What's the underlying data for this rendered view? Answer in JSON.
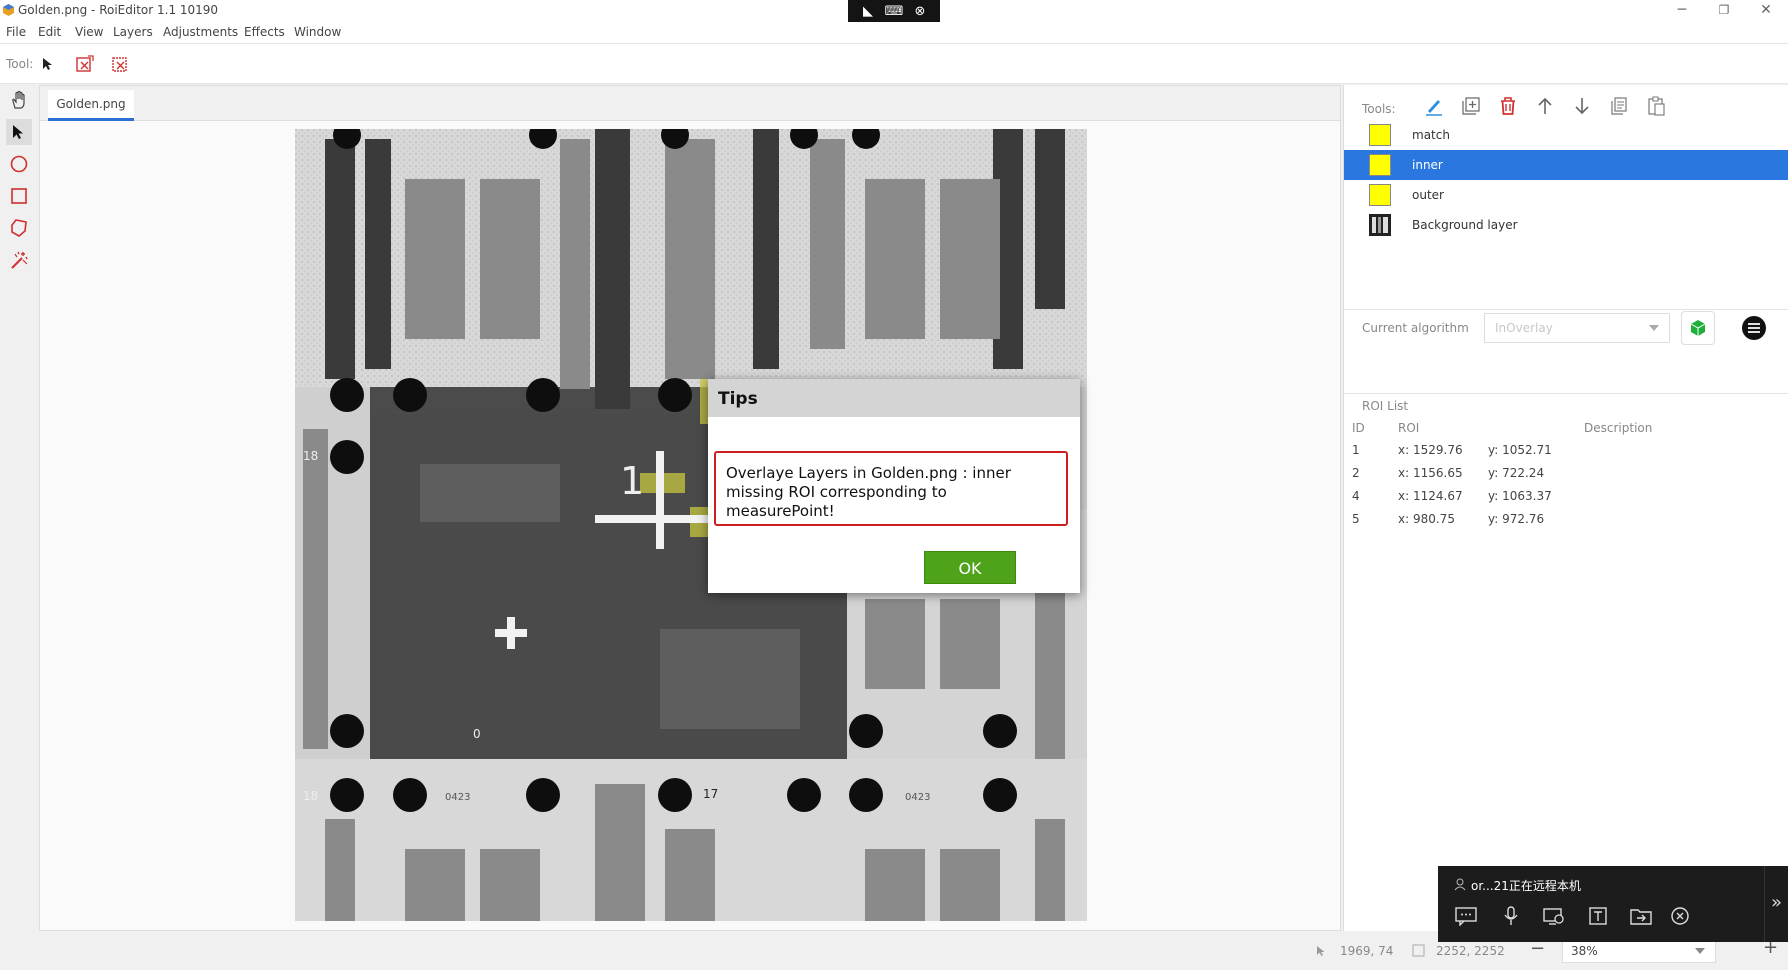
{
  "window": {
    "title": "Golden.png - RoiEditor 1.1 10190",
    "minimize": "─",
    "maximize": "❐",
    "close": "✕"
  },
  "menu": [
    "File",
    "Edit",
    "View",
    "Layers",
    "Adjustments",
    "Effects",
    "Window"
  ],
  "toolbar": {
    "tool_label": "Tool:"
  },
  "document": {
    "tab": "Golden.png"
  },
  "canvas_labels": {
    "num1": "1",
    "p18a": "18",
    "p18b": "18",
    "p17": "17",
    "p0": "0",
    "m1": "0423",
    "m2": "0423"
  },
  "right_panel": {
    "tools_label": "Tools:",
    "layers": [
      {
        "name": "match",
        "color": "#ffff00"
      },
      {
        "name": "inner",
        "color": "#ffff00",
        "selected": true
      },
      {
        "name": "outer",
        "color": "#ffff00"
      },
      {
        "name": "Background layer"
      }
    ],
    "algorithm_label": "Current algorithm",
    "algorithm_value": "InOverlay",
    "roi_list_title": "ROI List",
    "roi_headers": {
      "id": "ID",
      "roi": "ROI",
      "description": "Description"
    },
    "roi_rows": [
      {
        "id": "1",
        "x": "x: 1529.76",
        "y": "y: 1052.71"
      },
      {
        "id": "2",
        "x": "x: 1156.65",
        "y": "y: 722.24"
      },
      {
        "id": "4",
        "x": "x: 1124.67",
        "y": "y: 1063.37"
      },
      {
        "id": "5",
        "x": "x: 980.75",
        "y": "y: 972.76"
      }
    ]
  },
  "status": {
    "cursor": "1969, 74",
    "size": "2252, 2252",
    "zoom": "38%",
    "zoom_out": "−",
    "zoom_in": "+"
  },
  "dialog": {
    "title": "Tips",
    "message": "Overlaye Layers in Golden.png :    inner missing ROI corresponding to measurePoint!",
    "ok": "OK"
  },
  "remote": {
    "status": "or...21正在远程本机",
    "expand": "»"
  }
}
